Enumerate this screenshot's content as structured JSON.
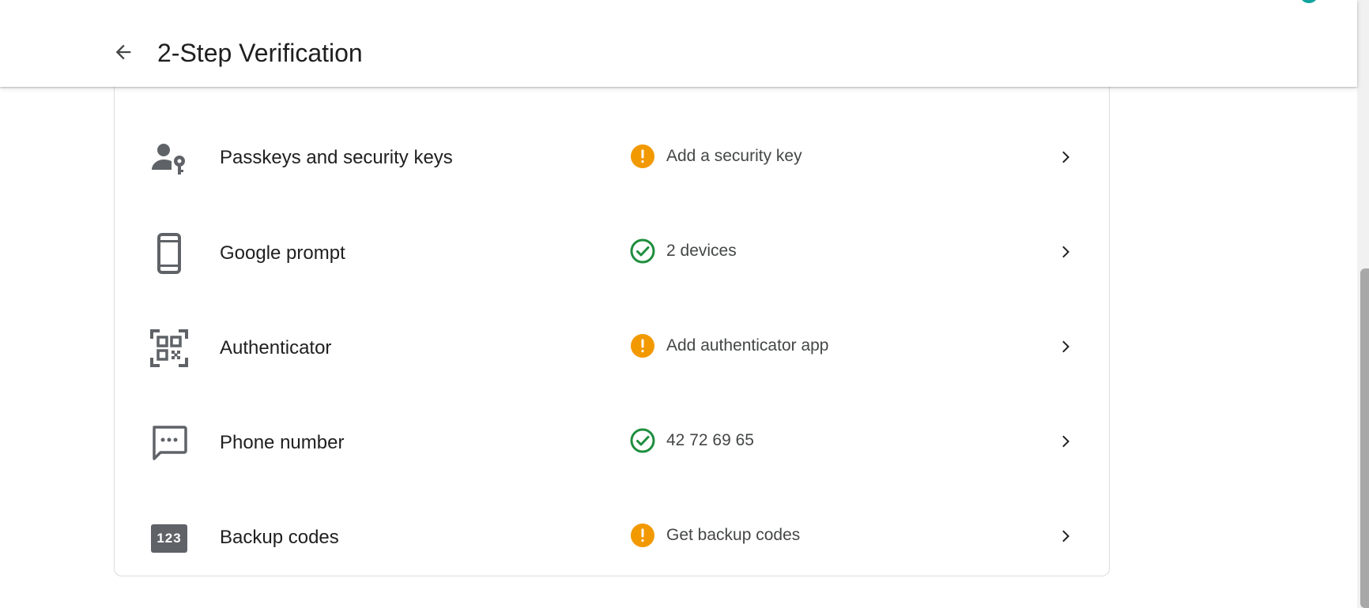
{
  "header": {
    "title": "2-Step Verification",
    "back_icon": "arrow-back-icon"
  },
  "colors": {
    "warning": "#f29900",
    "success": "#1e8e3e",
    "icon_gray": "#5f6368",
    "avatar": "#12a49d"
  },
  "methods": [
    {
      "label": "Passkeys and security keys",
      "icon": "person-key-icon",
      "status": "warning",
      "status_text": "Add a security key"
    },
    {
      "label": "Google prompt",
      "icon": "phone-icon",
      "status": "success",
      "status_text": "2 devices"
    },
    {
      "label": "Authenticator",
      "icon": "qr-code-icon",
      "status": "warning",
      "status_text": "Add authenticator app"
    },
    {
      "label": "Phone number",
      "icon": "sms-icon",
      "status": "success",
      "status_text": "42 72 69 65"
    },
    {
      "label": "Backup codes",
      "icon": "backup-codes-icon",
      "status": "warning",
      "status_text": "Get backup codes",
      "icon_text": "123"
    }
  ]
}
